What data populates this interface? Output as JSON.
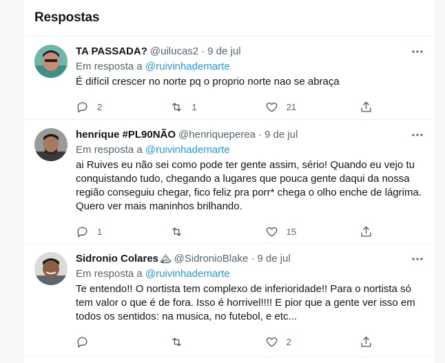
{
  "section_title": "Respostas",
  "reply_prefix": "Em resposta a",
  "tweets": [
    {
      "name": "TA PASSADA?",
      "handle": "@uilucas2",
      "date": "9 de jul",
      "reply_to": "@ruivinhademarte",
      "text": "É difícil crescer no norte pq o proprio norte nao se abraça",
      "replies": "2",
      "retweets": "1",
      "likes": "21",
      "avatar_colors": [
        "#6fb7a9",
        "#c98a76"
      ]
    },
    {
      "name": "henrique #PL90NÃO",
      "handle": "@henriqueperea",
      "date": "9 de jul",
      "reply_to": "@ruivinhademarte",
      "text": "ai Ruives eu não sei como pode ter gente assim, sério! Quando eu vejo tu conquistando tudo, chegando a lugares que pouca gente daqui da nossa região conseguiu chegar, fico feliz pra porr* chega o olho enche de lágrima. Quero ver mais maninhos brilhando.",
      "replies": "1",
      "retweets": "",
      "likes": "15",
      "avatar_colors": [
        "#9a9a9a",
        "#5a4a40"
      ]
    },
    {
      "name": "Sidronio Colares",
      "name_emoji": "🏔",
      "handle": "@SidronioBlake",
      "date": "9 de jul",
      "reply_to": "@ruivinhademarte",
      "text": "Te entendo!! O nortista tem complexo de inferioridade!! Para o nortista só tem valor o que é de fora. Isso é horrivel!!!! E pior que a gente ver isso em todos os sentidos: na musica, no futebol, e etc...",
      "replies": "",
      "retweets": "",
      "likes": "2",
      "avatar_colors": [
        "#d9dcd6",
        "#8a5f45"
      ]
    }
  ]
}
